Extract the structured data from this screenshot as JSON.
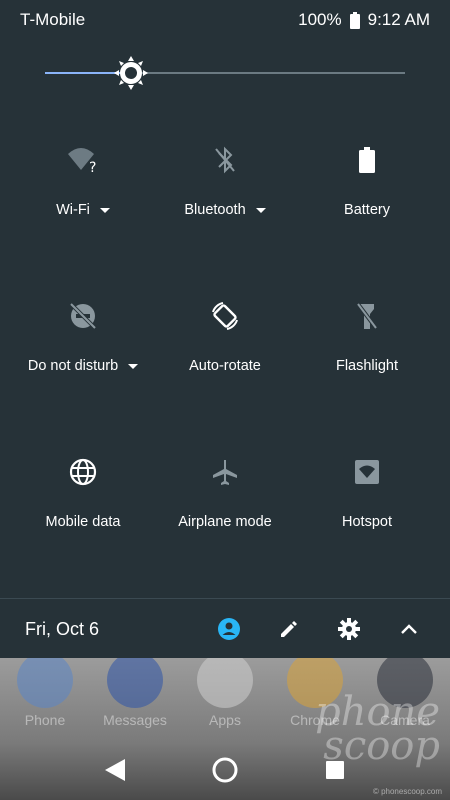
{
  "status": {
    "carrier": "T-Mobile",
    "battery_percent": "100%",
    "time": "9:12 AM"
  },
  "brightness": {
    "level": 0.24
  },
  "tiles": [
    {
      "label": "Wi-Fi",
      "icon": "wifi-question-icon",
      "has_dropdown": true
    },
    {
      "label": "Bluetooth",
      "icon": "bluetooth-off-icon",
      "has_dropdown": true
    },
    {
      "label": "Battery",
      "icon": "battery-icon",
      "has_dropdown": false
    },
    {
      "label": "Do not disturb",
      "icon": "dnd-off-icon",
      "has_dropdown": true
    },
    {
      "label": "Auto-rotate",
      "icon": "auto-rotate-icon",
      "has_dropdown": false
    },
    {
      "label": "Flashlight",
      "icon": "flashlight-off-icon",
      "has_dropdown": false
    },
    {
      "label": "Mobile data",
      "icon": "globe-icon",
      "has_dropdown": false
    },
    {
      "label": "Airplane mode",
      "icon": "airplane-icon",
      "has_dropdown": false
    },
    {
      "label": "Hotspot",
      "icon": "hotspot-icon",
      "has_dropdown": false
    }
  ],
  "footer": {
    "date": "Fri, Oct 6",
    "icons": [
      "user-icon",
      "edit-icon",
      "settings-icon",
      "collapse-icon"
    ]
  },
  "home": {
    "dock": [
      {
        "label": "Phone",
        "color": "#5b86c7"
      },
      {
        "label": "Messages",
        "color": "#2f55a8"
      },
      {
        "label": "Apps",
        "color": "#cfcfcf"
      },
      {
        "label": "Chrome",
        "color": "#d9a33a"
      },
      {
        "label": "Camera",
        "color": "#2a2f3a"
      }
    ]
  },
  "watermark": {
    "brand_line1": "phone",
    "brand_line2": "scoop",
    "url": "© phonescoop.com"
  },
  "colors": {
    "background": "#263238",
    "accent": "#29b6f6",
    "slider_fill": "#8ab4f8"
  }
}
